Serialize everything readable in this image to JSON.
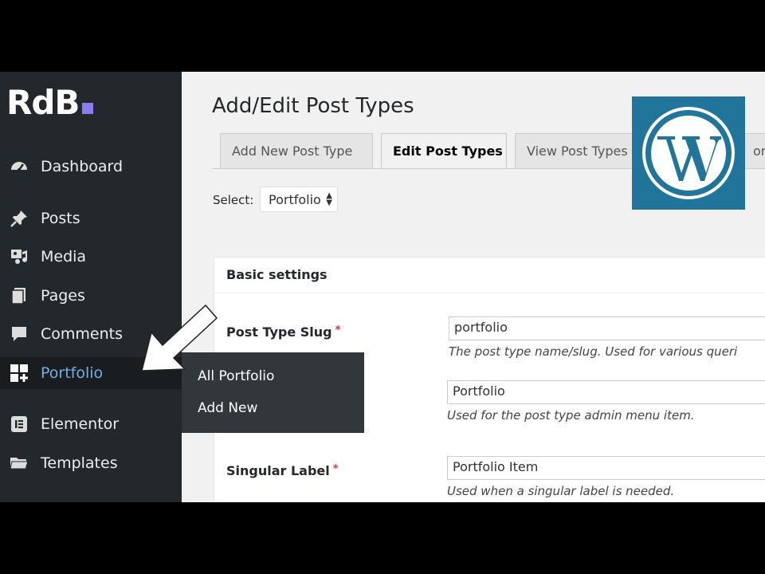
{
  "sidebar": {
    "logo": "RdB",
    "logo_dot_color": "#8c7cf0",
    "items": [
      {
        "label": "Dashboard",
        "icon": "dashboard-icon"
      },
      {
        "label": "Posts",
        "icon": "pin-icon"
      },
      {
        "label": "Media",
        "icon": "media-icon"
      },
      {
        "label": "Pages",
        "icon": "pages-icon"
      },
      {
        "label": "Comments",
        "icon": "comment-icon"
      },
      {
        "label": "Portfolio",
        "icon": "portfolio-icon",
        "active": true
      },
      {
        "label": "Elementor",
        "icon": "elementor-icon"
      },
      {
        "label": "Templates",
        "icon": "folder-icon"
      }
    ],
    "flyout": [
      "All Portfolio",
      "Add New"
    ]
  },
  "main": {
    "title": "Add/Edit Post Types",
    "tabs": [
      "Add New Post Type",
      "Edit Post Types",
      "View Post Types",
      "ort"
    ],
    "select_label": "Select:",
    "select_value": "Portfolio",
    "panel_title": "Basic settings",
    "fields": [
      {
        "label": "Post Type Slug",
        "required": "*",
        "value": "portfolio",
        "desc": "The post type name/slug. Used for various queri"
      },
      {
        "label": "",
        "value": "Portfolio",
        "desc": "Used for the post type admin menu item."
      },
      {
        "label": "Singular Label",
        "required": "*",
        "value": "Portfolio Item",
        "desc": "Used when a singular label is needed."
      }
    ]
  },
  "colors": {
    "sidebar_bg": "#23282d",
    "active_link": "#72aee6",
    "wordpress_blue": "#21759b",
    "required": "#dc3232"
  }
}
